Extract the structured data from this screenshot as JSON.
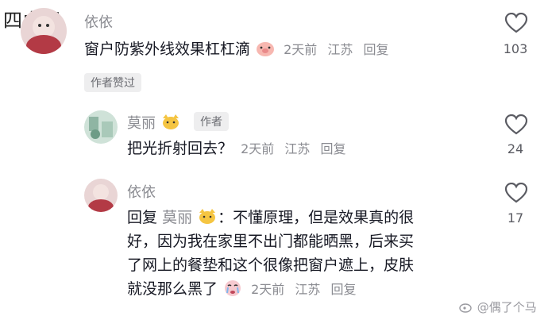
{
  "watermark_top": "四虎网",
  "watermark_bottom": "@偶了个马",
  "comments": [
    {
      "author": "依依",
      "text": "窗户防紫外线效果杠杠滴",
      "time": "2天前",
      "location": "江苏",
      "reply_label": "回复",
      "likes": "103",
      "author_liked_label": "作者赞过"
    },
    {
      "author": "莫丽",
      "author_badge": "作者",
      "text": "把光折射回去？",
      "time": "2天前",
      "location": "江苏",
      "reply_label": "回复",
      "likes": "24"
    },
    {
      "author": "依依",
      "reply_prefix": "回复",
      "reply_to": "莫丽",
      "text_lines": [
        "：不懂原理，但是效果真的很",
        "好，因为我在家里不出门都能晒黑，后来买",
        "了网上的餐垫和这个很像把窗户遮上，皮肤",
        "就没那么黑了"
      ],
      "time": "2天前",
      "location": "江苏",
      "reply_label": "回复",
      "likes": "17"
    }
  ],
  "colors": {
    "text": "#161823",
    "meta": "#8a8b91",
    "badge_bg": "#eeeeef"
  }
}
